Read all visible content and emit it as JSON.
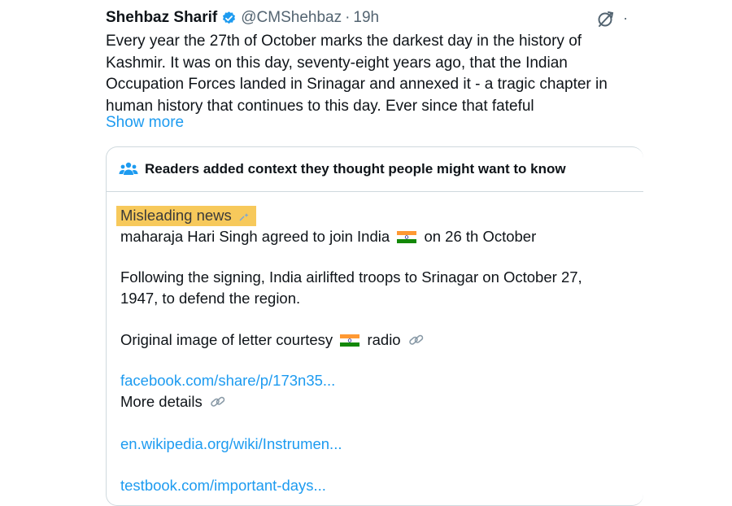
{
  "tweet": {
    "author": "Shehbaz Sharif",
    "handle": "@CMShehbaz",
    "separator": "·",
    "time": "19h",
    "more": "·",
    "text_lines": [
      "Every year the 27th of October marks the darkest day in the history of",
      "Kashmir. It was on this day, seventy-eight years ago, that the Indian",
      "Occupation Forces landed in Srinagar and annexed it - a tragic chapter in",
      "human history that continues to this day. Ever since that fateful"
    ],
    "show_more": "Show more"
  },
  "note": {
    "title": "Readers added context they thought people might want to know",
    "highlight": "Misleading news",
    "line1_a": "maharaja Hari Singh agreed to join India",
    "line1_b": "on 26 th October",
    "para2_l1": "Following the signing, India airlifted troops to Srinagar on October 27,",
    "para2_l2": "1947, to defend the region.",
    "letter_a": "Original image of letter courtesy",
    "letter_b": "radio",
    "link1": "facebook.com/share/p/173n35...",
    "more_details": "More details",
    "link2": "en.wikipedia.org/wiki/Instrumen...",
    "link3": "testbook.com/important-days..."
  },
  "colors": {
    "text": "#0f1419",
    "muted": "#536471",
    "link": "#1d9bf0",
    "verified": "#1d9bf0",
    "highlight": "#f7c95b",
    "border": "#cfd9de"
  },
  "icons": [
    "verified-badge-icon",
    "grok-icon",
    "people-icon",
    "sparkle-icon",
    "india-flag-icon",
    "link-icon"
  ]
}
